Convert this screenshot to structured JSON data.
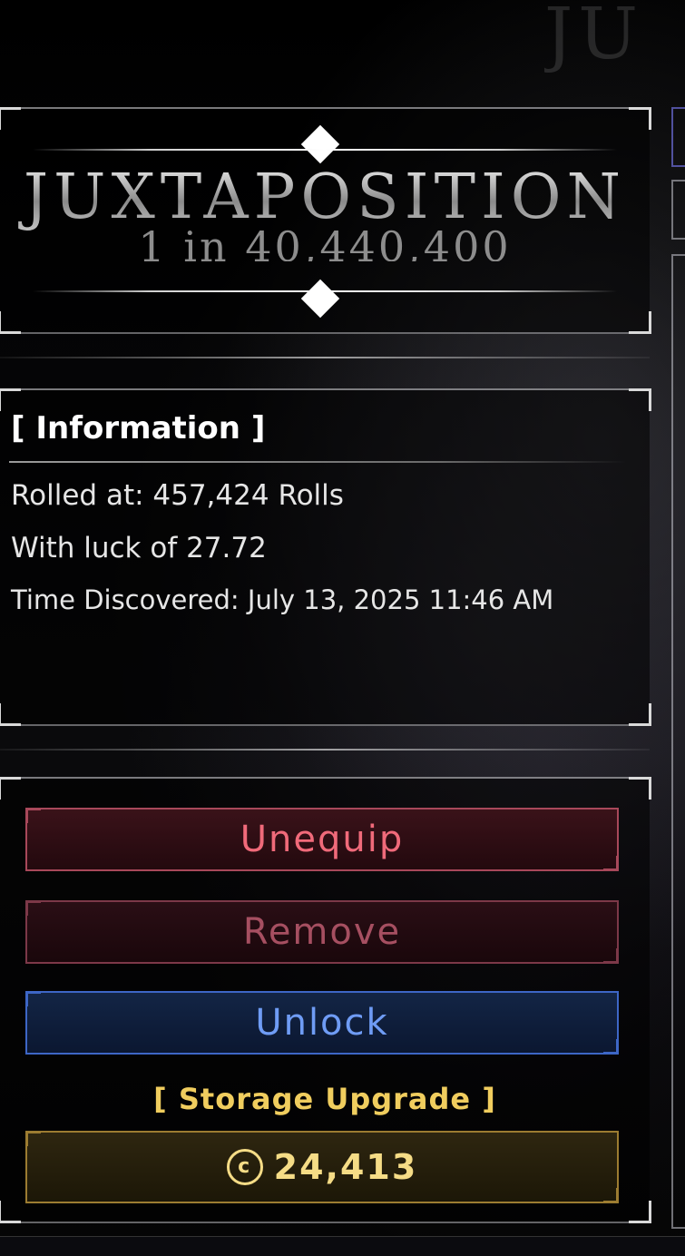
{
  "background": {
    "logo_text": "JU"
  },
  "aura": {
    "name": "JUXTAPOSITION",
    "odds": "1 in 40,440,400"
  },
  "info": {
    "title": "[ Information ]",
    "rolled_at": "Rolled at: 457,424 Rolls",
    "luck": "With luck of 27.72",
    "time_discovered": "Time Discovered: July 13, 2025 11:46 AM"
  },
  "actions": {
    "unequip_label": "Unequip",
    "remove_label": "Remove",
    "unlock_label": "Unlock",
    "storage_upgrade_label": "[ Storage Upgrade ]",
    "storage_upgrade_cost": "24,413",
    "currency_symbol": "c"
  },
  "colors": {
    "unequip": "#f06a7a",
    "remove": "#a64f61",
    "unlock": "#6f9cf5",
    "storage": "#f0cd5e"
  }
}
